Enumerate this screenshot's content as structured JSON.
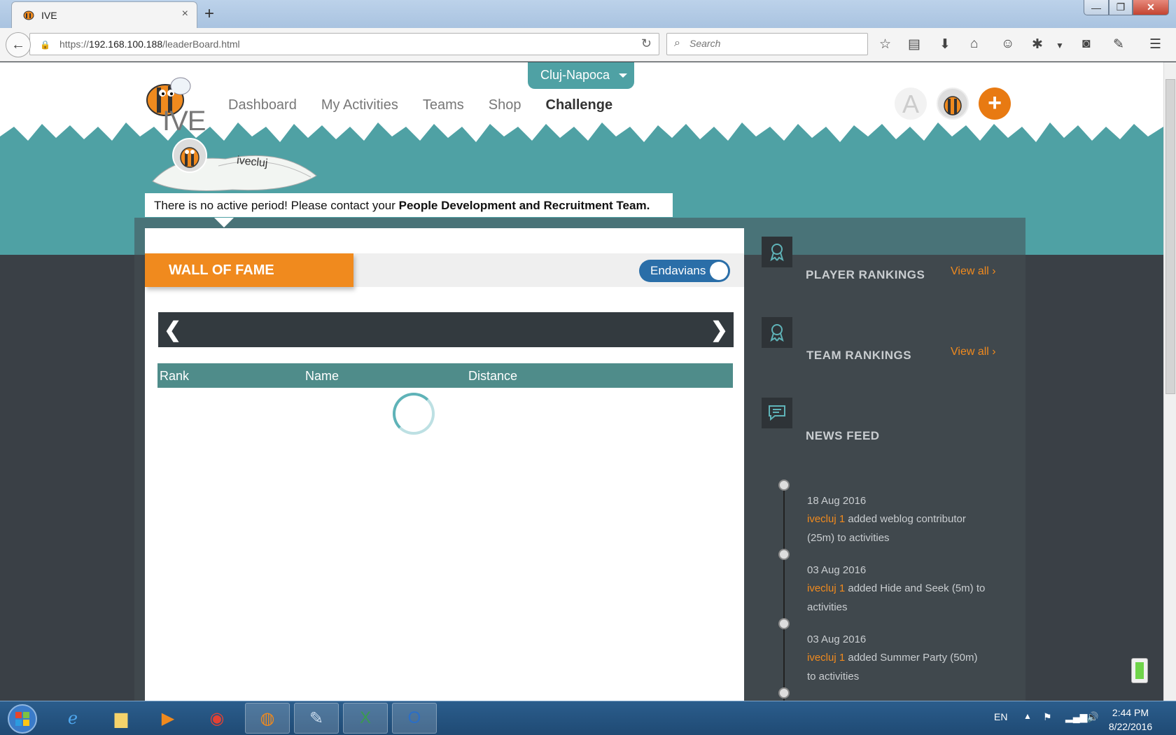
{
  "browser": {
    "tab_title": "IVE",
    "tab_close": "×",
    "new_tab": "+",
    "url_prefix": "https://",
    "url_host": "192.168.100.188",
    "url_path": "/leaderBoard.html",
    "search_placeholder": "Search",
    "window_min": "—",
    "window_max": "❐",
    "window_close": "✕"
  },
  "header": {
    "logo_text": "IVE",
    "city": "Cluj-Napoca",
    "username": "ivecluj",
    "nav": [
      "Dashboard",
      "My Activities",
      "Teams",
      "Shop",
      "Challenge"
    ],
    "active_nav": "Challenge",
    "avatar_initial": "A",
    "add_label": "+"
  },
  "notice": {
    "text": "There is no active period! Please contact your ",
    "bold": "People Development and Recruitment Team."
  },
  "wall_of_fame": {
    "title": "WALL OF FAME",
    "toggle_label": "Endavians",
    "prev": "‹",
    "next": "›",
    "columns": [
      "Rank",
      "Name",
      "Distance"
    ]
  },
  "sidebar": {
    "player_rankings": "PLAYER RANKINGS",
    "team_rankings": "TEAM RANKINGS",
    "news_feed": "NEWS FEED",
    "view_all": "View all  ›",
    "feed": [
      {
        "date": "18 Aug 2016",
        "user": "ivecluj 1",
        "text": " added weblog contributor (25m) to activities"
      },
      {
        "date": "03 Aug 2016",
        "user": "ivecluj 1",
        "text": " added Hide and Seek (5m) to activities"
      },
      {
        "date": "03 Aug 2016",
        "user": "ivecluj 1",
        "text": " added Summer Party (50m) to activities"
      }
    ]
  },
  "taskbar": {
    "language": "EN",
    "time": "2:44 PM",
    "date": "8/22/2016"
  },
  "colors": {
    "teal": "#4fa1a4",
    "orange": "#f08a1e",
    "dark": "#3a4046",
    "toggle_blue": "#2a6ea8"
  }
}
